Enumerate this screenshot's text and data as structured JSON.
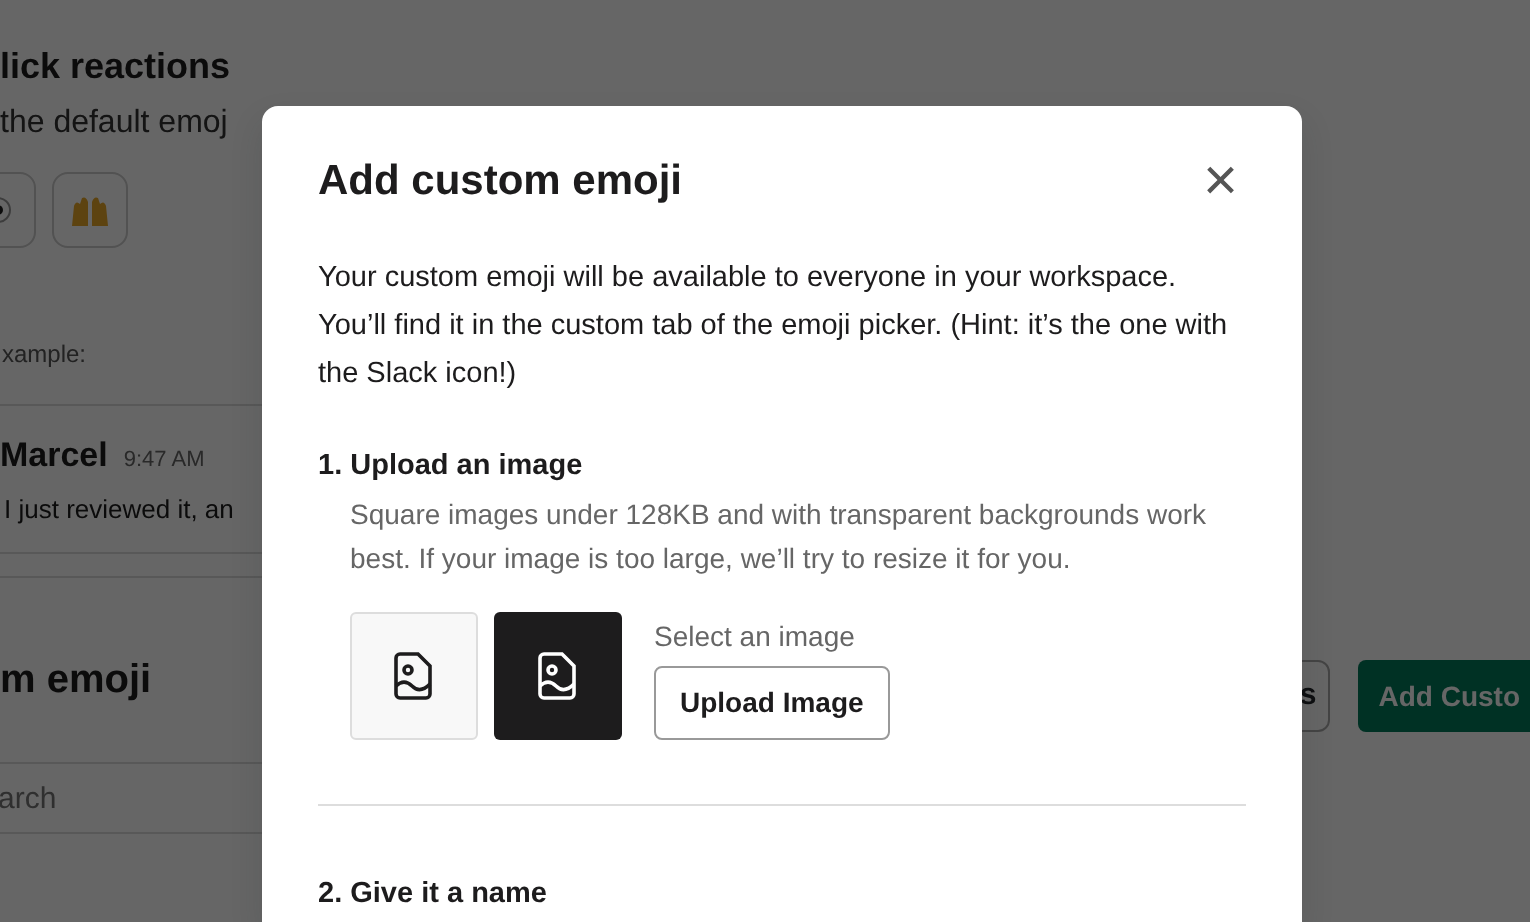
{
  "background": {
    "section_title": "lick reactions",
    "section_subtitle": "the default emoj",
    "reaction_buttons": [
      {
        "kind": "eye"
      },
      {
        "kind": "hands"
      }
    ],
    "example_label": "xample:",
    "message": {
      "author": "Marcel",
      "time": "9:47 AM",
      "text": "I just reviewed it, an"
    },
    "custom_title": "m emoji",
    "right_buttons": [
      {
        "label": "s",
        "kind": "outline"
      },
      {
        "label": "Add Custo",
        "kind": "primary"
      }
    ],
    "search": {
      "placeholder": "arch"
    }
  },
  "modal": {
    "title": "Add custom emoji",
    "close": "×",
    "intro": "Your custom emoji will be available to everyone in your workspace. You’ll find it in the custom tab of the emoji picker. (Hint: it’s the one with the Slack icon!)",
    "steps": [
      {
        "heading": "1. Upload an image",
        "description": "Square images under 128KB and with transparent backgrounds work best. If your image is too large, we’ll try to resize it for you.",
        "previews": [
          {
            "dark": false
          },
          {
            "dark": true
          }
        ],
        "select_label": "Select an image",
        "button": "Upload Image"
      },
      {
        "heading": "2. Give it a name"
      }
    ]
  }
}
